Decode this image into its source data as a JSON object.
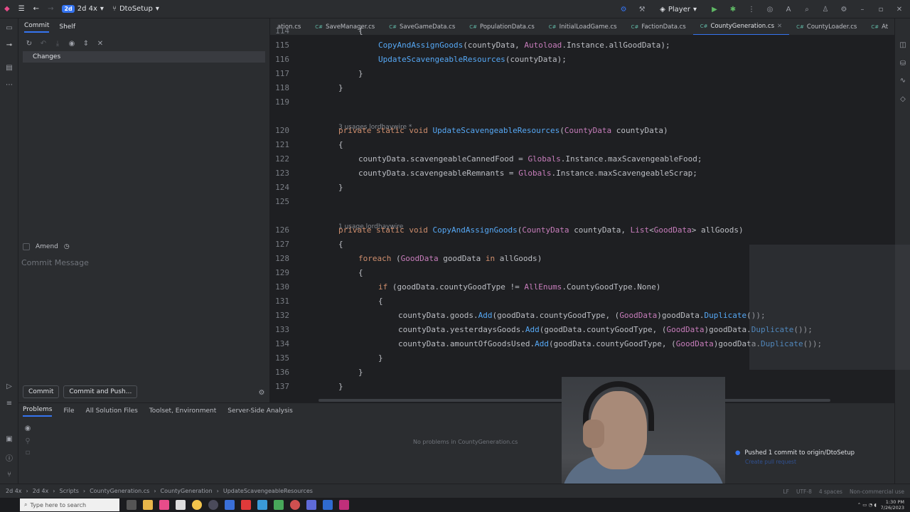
{
  "titlebar": {
    "project_badge": "2d",
    "project_name": "2d 4x",
    "branch": "DtoSetup",
    "run_config": "Player"
  },
  "commit_panel": {
    "tabs": [
      "Commit",
      "Shelf"
    ],
    "changes_label": "Changes",
    "amend_label": "Amend",
    "commit_message_placeholder": "Commit Message",
    "commit_button": "Commit",
    "commit_push_button": "Commit and Push..."
  },
  "editor": {
    "tabs": [
      {
        "label": "ation.cs",
        "active": false
      },
      {
        "label": "SaveManager.cs",
        "active": false
      },
      {
        "label": "SaveGameData.cs",
        "active": false
      },
      {
        "label": "PopulationData.cs",
        "active": false
      },
      {
        "label": "InitialLoadGame.cs",
        "active": false
      },
      {
        "label": "FactionData.cs",
        "active": false
      },
      {
        "label": "CountyGeneration.cs",
        "active": true
      },
      {
        "label": "CountyLoader.cs",
        "active": false
      },
      {
        "label": "At",
        "active": false
      }
    ],
    "lines": [
      {
        "n": "114",
        "text": "{"
      },
      {
        "n": "115",
        "text": "CopyAndAssignGoods(countyData, Autoload.Instance.allGoodData);"
      },
      {
        "n": "116",
        "text": "UpdateScavengeableResources(countyData);"
      },
      {
        "n": "117",
        "text": "}"
      },
      {
        "n": "118",
        "text": "}"
      },
      {
        "n": "119",
        "text": ""
      },
      {
        "n": "120",
        "text": "private static void UpdateScavengeableResources(CountyData countyData)"
      },
      {
        "n": "121",
        "text": "{"
      },
      {
        "n": "122",
        "text": "countyData.scavengeableCannedFood = Globals.Instance.maxScavengeableFood;"
      },
      {
        "n": "123",
        "text": "countyData.scavengeableRemnants = Globals.Instance.maxScavengeableScrap;"
      },
      {
        "n": "124",
        "text": "}"
      },
      {
        "n": "125",
        "text": ""
      },
      {
        "n": "126",
        "text": "private static void CopyAndAssignGoods(CountyData countyData, List<GoodData> allGoods)"
      },
      {
        "n": "127",
        "text": "{"
      },
      {
        "n": "128",
        "text": "foreach (GoodData goodData in allGoods)"
      },
      {
        "n": "129",
        "text": "{"
      },
      {
        "n": "130",
        "text": "if (goodData.countyGoodType != AllEnums.CountyGoodType.None)"
      },
      {
        "n": "131",
        "text": "{"
      },
      {
        "n": "132",
        "text": "countyData.goods.Add(goodData.countyGoodType, (GoodData)goodData.Duplicate());"
      },
      {
        "n": "133",
        "text": "countyData.yesterdaysGoods.Add(goodData.countyGoodType, (GoodData)goodData.Duplicate());"
      },
      {
        "n": "134",
        "text": "countyData.amountOfGoodsUsed.Add(goodData.countyGoodType, (GoodData)goodData.Duplicate());"
      },
      {
        "n": "135",
        "text": "}"
      },
      {
        "n": "136",
        "text": "}"
      },
      {
        "n": "137",
        "text": "}"
      }
    ],
    "hint_1": "3 usages   lordhaywire *",
    "hint_2": "1 usage   lordhaywire"
  },
  "bottom_panel": {
    "tabs": [
      "Problems",
      "File",
      "All Solution Files",
      "Toolset, Environment",
      "Server-Side Analysis"
    ],
    "no_problems": "No problems in CountyGeneration.cs"
  },
  "notification": {
    "title": "Pushed 1 commit to origin/DtoSetup",
    "subtitle": "Create pull request"
  },
  "statusbar": {
    "breadcrumbs": [
      "2d 4x",
      "2d 4x",
      "Scripts",
      "CountyGeneration.cs",
      "CountyGeneration",
      "UpdateScavengeableResources"
    ],
    "right_items": [
      "LF",
      "UTF-8",
      "4 spaces",
      "Non-commercial use"
    ]
  },
  "taskbar": {
    "search_placeholder": "Type here to search",
    "time": "1:30 PM",
    "date": "7/26/2023"
  },
  "colors": {
    "accent": "#3574f0",
    "keyword": "#cf8e6d",
    "type": "#c77dbb",
    "method": "#56a8f5"
  }
}
